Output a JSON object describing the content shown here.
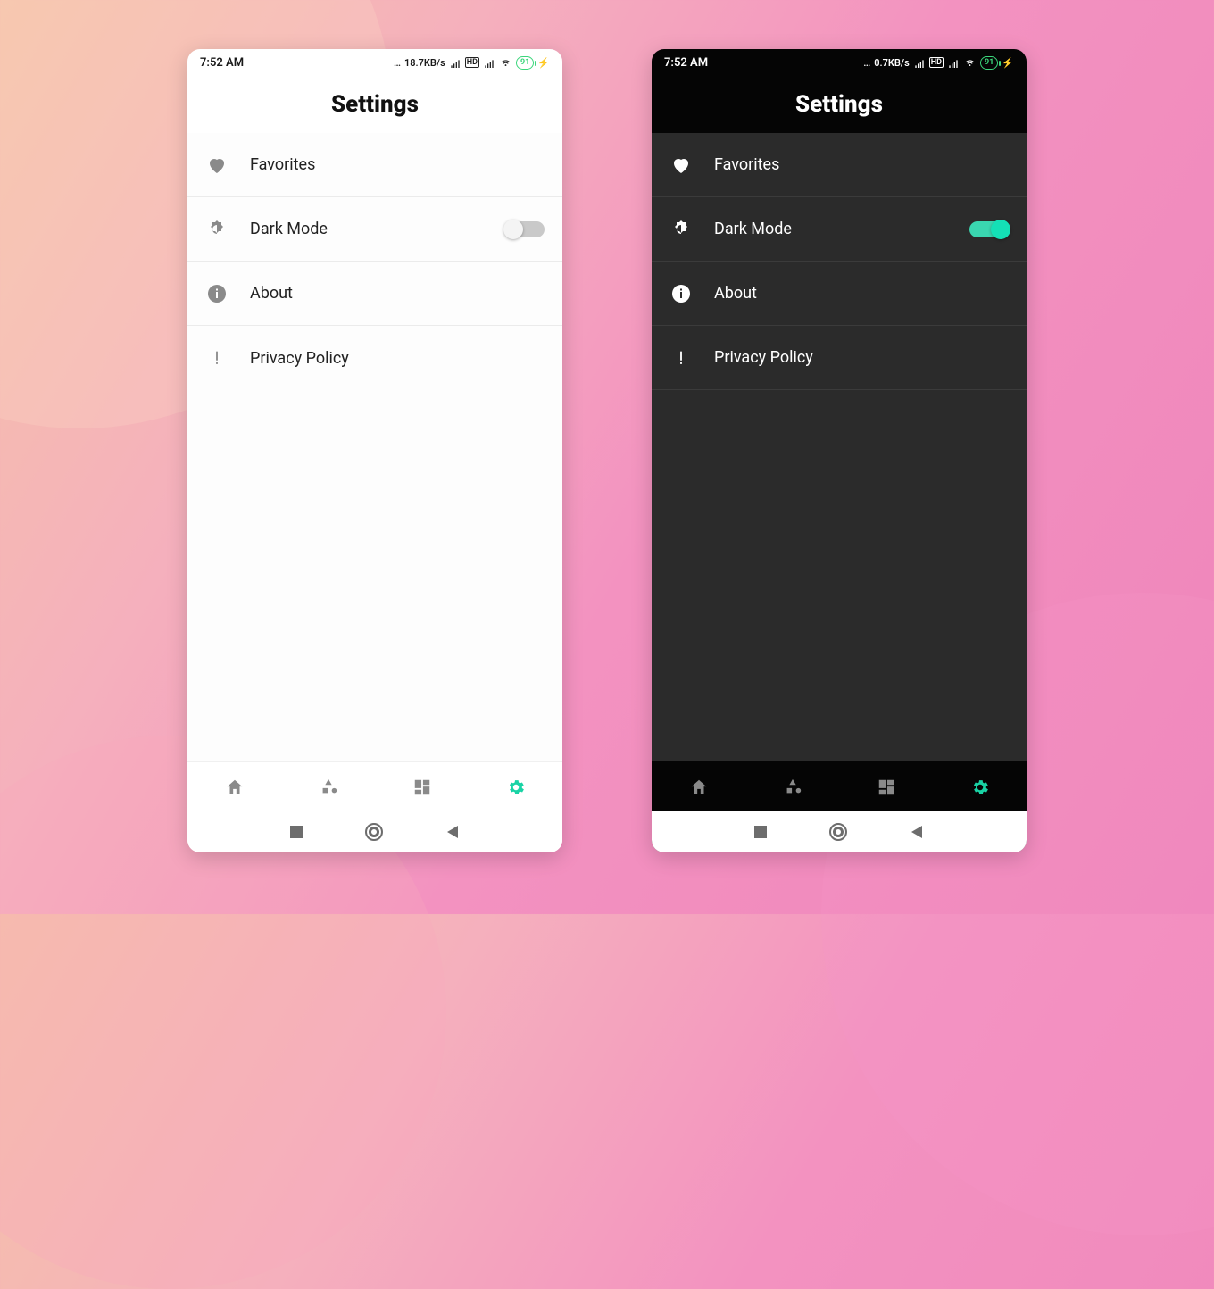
{
  "accent": "#19d3a5",
  "light": {
    "status": {
      "time": "7:52 AM",
      "net": "18.7KB/s",
      "battery": "91"
    },
    "title": "Settings",
    "rows": {
      "fav": {
        "label": "Favorites"
      },
      "dark": {
        "label": "Dark Mode",
        "toggle": false
      },
      "about": {
        "label": "About"
      },
      "priv": {
        "label": "Privacy Policy"
      }
    },
    "nav": {
      "home": "home",
      "cat": "category",
      "dash": "dashboard",
      "settings": "settings",
      "active": "settings"
    }
  },
  "dark": {
    "status": {
      "time": "7:52 AM",
      "net": "0.7KB/s",
      "battery": "91"
    },
    "title": "Settings",
    "rows": {
      "fav": {
        "label": "Favorites"
      },
      "dark": {
        "label": "Dark Mode",
        "toggle": true
      },
      "about": {
        "label": "About"
      },
      "priv": {
        "label": "Privacy Policy"
      }
    },
    "nav": {
      "home": "home",
      "cat": "category",
      "dash": "dashboard",
      "settings": "settings",
      "active": "settings"
    }
  }
}
